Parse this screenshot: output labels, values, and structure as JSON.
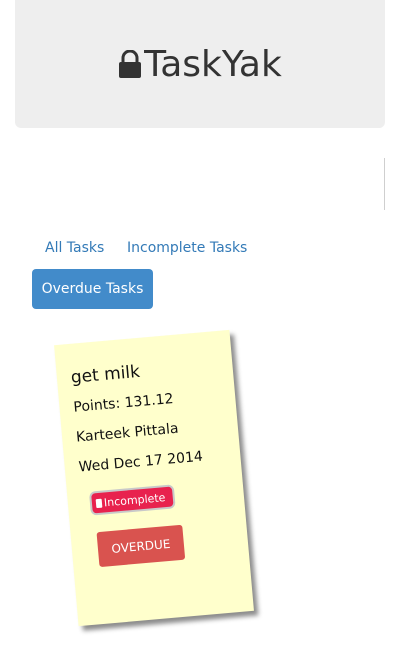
{
  "header": {
    "title": "TaskYak",
    "icon": "lock-icon"
  },
  "tabs": [
    {
      "label": "All Tasks",
      "active": false
    },
    {
      "label": "Incomplete Tasks",
      "active": false
    },
    {
      "label": "Overdue Tasks",
      "active": true
    }
  ],
  "tasks": [
    {
      "title": "get milk",
      "points": "Points: 131.12",
      "assignee": "Karteek Pittala",
      "date": "Wed Dec 17 2014",
      "status": "Incomplete",
      "action": "OVERDUE"
    }
  ],
  "colors": {
    "header_bg": "#eeeeee",
    "link": "#337ab7",
    "active_tab": "#428bca",
    "note_bg": "#ffffcc",
    "badge": "#e8224e",
    "overdue": "#d9534f"
  }
}
